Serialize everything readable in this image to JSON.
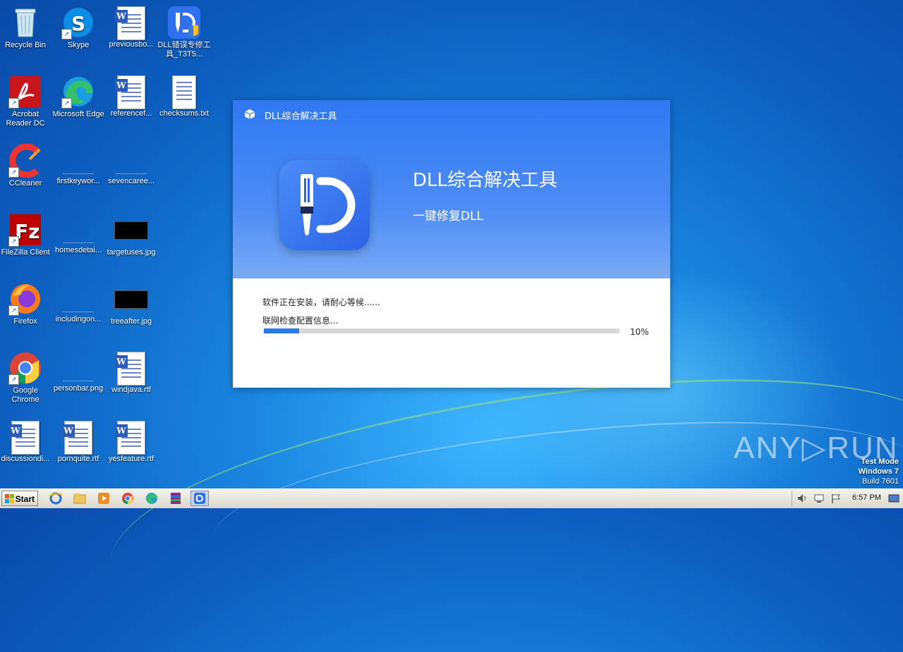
{
  "desktop": {
    "icons": [
      {
        "label": "Recycle Bin"
      },
      {
        "label": "Skype"
      },
      {
        "label": "previousbo..."
      },
      {
        "label": "DLL错误专修工具_T3T5..."
      },
      {
        "label": "Acrobat Reader DC"
      },
      {
        "label": "Microsoft Edge"
      },
      {
        "label": "referencef..."
      },
      {
        "label": "checksums.txt"
      },
      {
        "label": "CCleaner"
      },
      {
        "label": "firstkeywor..."
      },
      {
        "label": "sevencaree..."
      },
      {
        "label": "FileZilla Client"
      },
      {
        "label": "homesdetai..."
      },
      {
        "label": "targetuses.jpg"
      },
      {
        "label": "Firefox"
      },
      {
        "label": "includingon..."
      },
      {
        "label": "treeafter.jpg"
      },
      {
        "label": "Google Chrome"
      },
      {
        "label": "personbar.png"
      },
      {
        "label": "windjava.rtf"
      },
      {
        "label": "discussiondi..."
      },
      {
        "label": "pornquite.rtf"
      },
      {
        "label": "yesfeature.rtf"
      }
    ]
  },
  "dialog": {
    "title": "DLL综合解决工具",
    "app_name": "DLL综合解决工具",
    "app_subtitle": "一键修复DLL",
    "status_main": "软件正在安装，请耐心等候......",
    "status_detail": "联网检查配置信息...",
    "progress": 0.1,
    "progress_label": "10%"
  },
  "watermark": {
    "brand": "ANY▷RUN",
    "line1": "Test Mode",
    "line2": "Windows 7",
    "line3": "Build 7601"
  },
  "taskbar": {
    "start_label": "Start",
    "clock": "6:57 PM"
  },
  "colors": {
    "accent": "#2b78e9",
    "dialog_header": "#2f78f2"
  }
}
